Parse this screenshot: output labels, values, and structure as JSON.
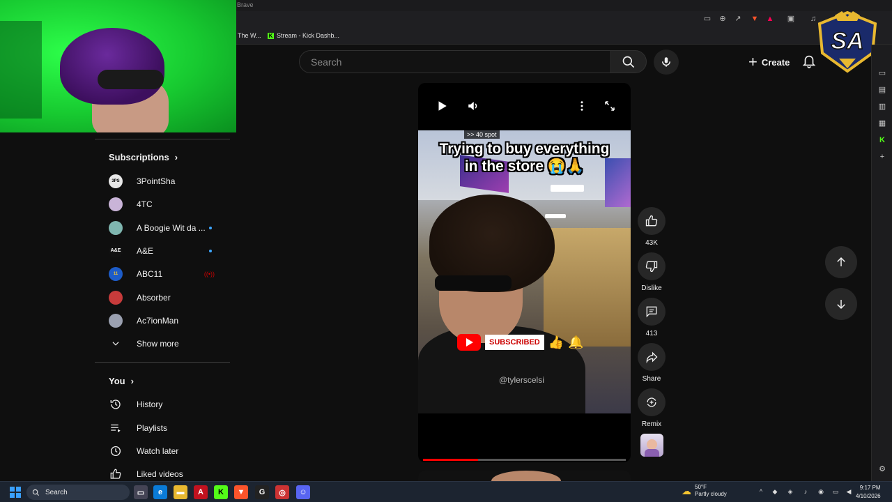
{
  "browser": {
    "title_fragment": "Brave",
    "bookmarks": [
      {
        "label": "The W..."
      },
      {
        "label": "Stream - Kick Dashb..."
      }
    ]
  },
  "header": {
    "search_placeholder": "Search",
    "create_label": "Create"
  },
  "guide": {
    "subscriptions_heading": "Subscriptions",
    "subscriptions": [
      {
        "name": "3PointSha",
        "badge": "none",
        "avatar_color": "#e8e8e8"
      },
      {
        "name": "4TC",
        "badge": "none",
        "avatar_color": "#c9b4d8"
      },
      {
        "name": "A Boogie Wit da ...",
        "badge": "new",
        "avatar_color": "#7fb6b0"
      },
      {
        "name": "A&E",
        "badge": "new",
        "avatar_color": "#111111"
      },
      {
        "name": "ABC11",
        "badge": "live",
        "avatar_color": "#1d5cc8"
      },
      {
        "name": "Absorber",
        "badge": "none",
        "avatar_color": "#c73b3b"
      },
      {
        "name": "Ac7ionMan",
        "badge": "none",
        "avatar_color": "#9aa0b0"
      }
    ],
    "show_more_label": "Show more",
    "you_heading": "You",
    "you_items": [
      {
        "label": "History",
        "icon": "history-icon"
      },
      {
        "label": "Playlists",
        "icon": "playlists-icon"
      },
      {
        "label": "Watch later",
        "icon": "watch-later-icon"
      },
      {
        "label": "Liked videos",
        "icon": "liked-videos-icon"
      }
    ]
  },
  "short": {
    "overlay_tag": ">> 40 spot",
    "overlay_title_line1": "Trying to buy everything",
    "overlay_title_line2": "in the store 😭🙏",
    "subscribed_label": "SUBSCRIBED",
    "watermark": "@tylerscelsi",
    "progress": 0.27
  },
  "actions": {
    "like_count": "43K",
    "dislike_label": "Dislike",
    "comment_count": "413",
    "share_label": "Share",
    "remix_label": "Remix"
  },
  "taskbar": {
    "search_label": "Search",
    "weather_temp": "50°F",
    "weather_desc": "Partly cloudy",
    "time": "9:17 PM",
    "date": "4/10/2026"
  },
  "colors": {
    "background": "#0f0f0f",
    "accent_red": "#ff0000",
    "chip_bg": "#272727",
    "new_dot": "#3ea6ff",
    "kick_green": "#53fc18"
  }
}
